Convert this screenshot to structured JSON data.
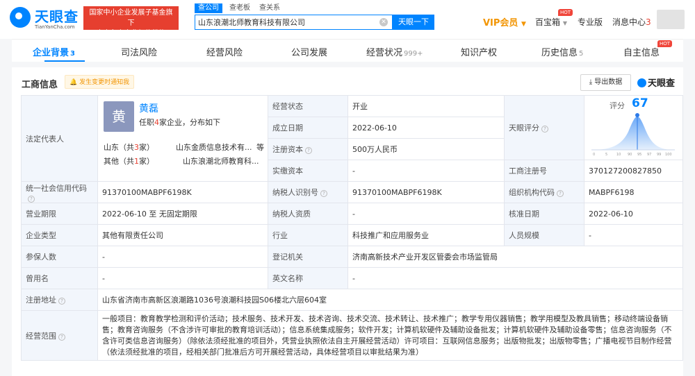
{
  "header": {
    "logo_name": "天眼查",
    "logo_url": "TianYanCha.com",
    "gov_badge_line1": "国家中小企业发展子基金旗下",
    "gov_badge_line2": "官方备案企业征信机构",
    "search_tabs": [
      "查公司",
      "查老板",
      "查关系"
    ],
    "search_value": "山东浪潮北师教育科技有限公司",
    "search_button": "天眼一下",
    "vip": "VIP会员",
    "treasure": "百宝箱",
    "treasure_hot": "HOT",
    "pro": "专业版",
    "messages": "消息中心",
    "messages_count": "3"
  },
  "tabs": [
    {
      "label": "企业背景",
      "count": "3"
    },
    {
      "label": "司法风险",
      "count": ""
    },
    {
      "label": "经营风险",
      "count": ""
    },
    {
      "label": "公司发展",
      "count": ""
    },
    {
      "label": "经营状况",
      "count": "999+"
    },
    {
      "label": "知识产权",
      "count": ""
    },
    {
      "label": "历史信息",
      "count": "5"
    },
    {
      "label": "自主信息",
      "count": ""
    }
  ],
  "tab_hot": "HOT",
  "section": {
    "title": "工商信息",
    "notify": "发生变更时通知我",
    "export": "导出数据",
    "brand": "天眼查"
  },
  "legal_rep": {
    "label": "法定代表人",
    "avatar_char": "黄",
    "name": "黄磊",
    "desc_pre": "任职",
    "desc_count": "4",
    "desc_post": "家企业，分布如下",
    "region1_pre": "山东（共",
    "region1_count": "3",
    "region1_post": "家）",
    "region1_company": "山东金质信息技术有...",
    "region1_more": "等",
    "region2_pre": "其他（共",
    "region2_count": "1",
    "region2_post": "家）",
    "region2_company": "山东浪潮北师教育科..."
  },
  "score": {
    "label": "评分",
    "value": "67",
    "axis": [
      "0",
      "5",
      "10",
      "90",
      "95",
      "97",
      "99",
      "100"
    ]
  },
  "fields": {
    "status_label": "经营状态",
    "status": "开业",
    "est_label": "成立日期",
    "est": "2022-06-10",
    "tyscore_label": "天眼评分",
    "reg_cap_label": "注册资本",
    "reg_cap": "500万人民币",
    "paid_cap_label": "实缴资本",
    "paid_cap": "-",
    "reg_no_label": "工商注册号",
    "reg_no": "370127200827850",
    "credit_label": "统一社会信用代码",
    "credit": "91370100MABPF6198K",
    "tax_label": "纳税人识别号",
    "tax": "91370100MABPF6198K",
    "org_label": "组织机构代码",
    "org": "MABPF6198",
    "term_label": "营业期限",
    "term": "2022-06-10 至 无固定期限",
    "taxq_label": "纳税人资质",
    "taxq": "-",
    "approve_label": "核准日期",
    "approve": "2022-06-10",
    "type_label": "企业类型",
    "type": "其他有限责任公司",
    "industry_label": "行业",
    "industry": "科技推广和应用服务业",
    "staff_label": "人员规模",
    "staff": "-",
    "insured_label": "参保人数",
    "insured": "-",
    "authority_label": "登记机关",
    "authority": "济南高新技术产业开发区管委会市场监管局",
    "former_label": "曾用名",
    "former": "-",
    "en_label": "英文名称",
    "en": "-",
    "addr_label": "注册地址",
    "addr": "山东省济南市高新区浪潮路1036号浪潮科技园S06楼北六层604室",
    "scope_label": "经营范围",
    "scope": "一般项目：教育教学检测和评价活动；技术服务、技术开发、技术咨询、技术交流、技术转让、技术推广；教学专用仪器销售；教学用模型及教具销售；移动终端设备销售；教育咨询服务（不含涉许可审批的教育培训活动）；信息系统集成服务；软件开发；计算机软硬件及辅助设备批发；计算机软硬件及辅助设备零售；信息咨询服务（不含许可类信息咨询服务）（除依法须经批准的项目外，凭营业执照依法自主开展经营活动）许可项目：互联网信息服务；出版物批发；出版物零售；广播电视节目制作经营（依法须经批准的项目，经相关部门批准后方可开展经营活动，具体经营项目以审批结果为准）"
  },
  "colors": {
    "accent": "#0084ff",
    "red": "#e63f2f",
    "vip": "#f29503",
    "label_bg": "#f2f6fc"
  }
}
